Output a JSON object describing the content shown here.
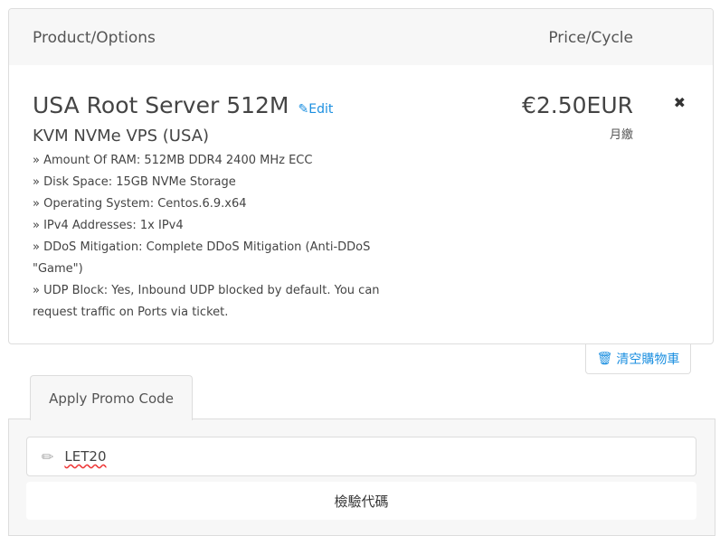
{
  "header": {
    "product_col": "Product/Options",
    "price_col": "Price/Cycle"
  },
  "item": {
    "name": "USA Root Server 512M",
    "edit_label": "Edit",
    "group": "KVM NVMe VPS (USA)",
    "options": [
      "» Amount Of RAM: 512MB DDR4 2400 MHz ECC",
      "» Disk Space: 15GB NVMe Storage",
      "» Operating System: Centos.6.9.x64",
      "» IPv4 Addresses: 1x IPv4",
      "» DDoS Mitigation: Complete DDoS Mitigation (Anti-DDoS \"Game\")",
      "» UDP Block: Yes, Inbound UDP blocked by default. You can request traffic on Ports via ticket."
    ],
    "price": "€2.50EUR",
    "cycle": "月繳",
    "remove_icon": "close-icon"
  },
  "empty_cart_label": "清空購物車",
  "promo": {
    "tab_label": "Apply Promo Code",
    "value": "LET20",
    "validate_label": "檢驗代碼"
  },
  "colors": {
    "accent": "#1b8fe0"
  }
}
